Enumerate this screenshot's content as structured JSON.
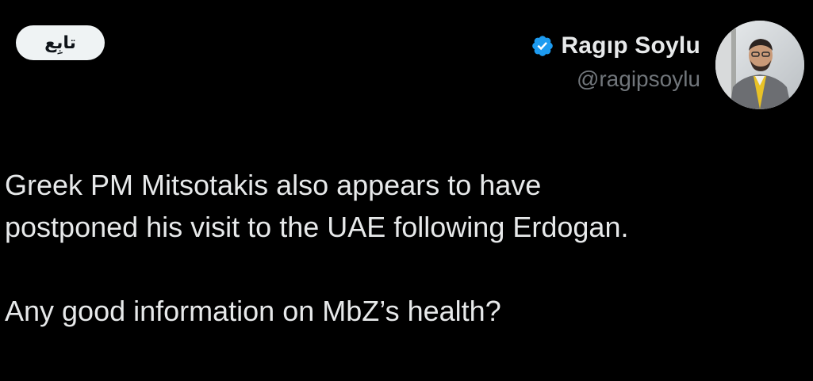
{
  "tweet": {
    "follow_label": "تابِع",
    "author": {
      "display_name": "Ragıp Soylu",
      "handle": "@ragipsoylu",
      "verified": true,
      "verified_color": "#1d9bf0"
    },
    "text_lines": [
      "Greek PM Mitsotakis also appears to have",
      "postponed his visit to the UAE following Erdogan.",
      "Any good information on MbZ’s health?"
    ]
  },
  "colors": {
    "background": "#000000",
    "text_primary": "#e7e9ea",
    "text_secondary": "#71767b",
    "follow_bg": "#eff3f4"
  }
}
